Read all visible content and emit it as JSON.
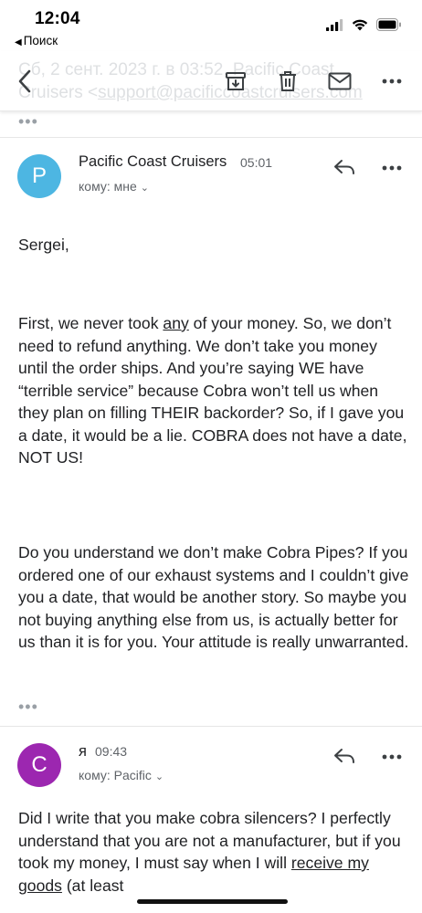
{
  "status_bar": {
    "time": "12:04",
    "back_label": "Поиск",
    "back_glyph": "◀"
  },
  "toolbar": {
    "subject_line1": "Сб, 2 сент. 2023 г. в 03:52, Pacific Coast",
    "subject_line2_a": "Cruisers <",
    "subject_line2_email": "support@pacificcoastcruisers.com",
    "icons": [
      "back-icon",
      "archive-icon",
      "delete-icon",
      "mark-unread-icon",
      "more-icon"
    ]
  },
  "collapsed_top": "•••",
  "message1": {
    "avatar_letter": "P",
    "avatar_color": "#4db6e2",
    "sender": "Pacific Coast Cruisers",
    "time": "05:01",
    "recipient": "кому: мне",
    "greeting": "Sergei,",
    "para1_pre": "First, we never took ",
    "para1_underlined": "any",
    "para1_post": " of your money. So, we don’t need to refund anything. We don’t take you money until the order ships. And you’re saying WE have “terrible service” because Cobra won’t tell us when they plan on filling THEIR backorder? So, if I gave you a date, it would be a lie. COBRA does not have a date, NOT US!",
    "para2": "Do you understand we don’t make Cobra Pipes? If you ordered one of our exhaust systems and I couldn’t give you a date, that would be another story. So maybe you not buying anything else from us, is actually better for us than it is for you. Your attitude is really unwarranted.",
    "quoted_dots": "•••"
  },
  "message2": {
    "avatar_letter": "C",
    "avatar_color": "#9c27b0",
    "sender": "я",
    "time": "09:43",
    "recipient": "кому: Pacific",
    "body_pre": "Did I write that you make cobra silencers? I perfectly understand that you are not a manufacturer, but if you took my money, I must say when I will ",
    "body_underlined": "receive my goods",
    "body_post": " (at least"
  },
  "chevron_glyph": "⌄"
}
